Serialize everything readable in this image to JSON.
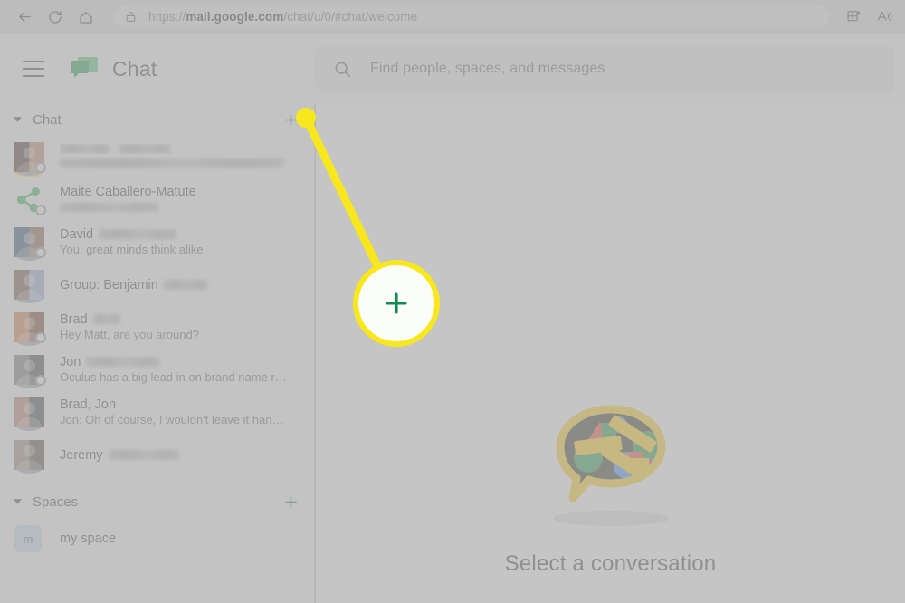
{
  "browser": {
    "back_icon": "back-arrow-icon",
    "reload_icon": "reload-icon",
    "home_icon": "home-icon",
    "lock_icon": "lock-icon",
    "url_prefix": "https://",
    "url_domain": "mail.google.com",
    "url_path": "/chat/u/0/#chat/welcome",
    "url_full": "https://mail.google.com/chat/u/0/#chat/welcome",
    "collections_icon": "add-to-collections-icon",
    "read_aloud_icon": "read-aloud-icon"
  },
  "header": {
    "menu_icon": "hamburger-menu-icon",
    "logo_icon": "google-chat-logo-icon",
    "title": "Chat"
  },
  "search": {
    "icon": "search-icon",
    "placeholder": "Find people, spaces, and messages"
  },
  "sidebar": {
    "chat_section": {
      "label": "Chat",
      "caret_icon": "caret-down-icon",
      "add_icon": "plus-icon"
    },
    "conversations": [
      {
        "name": "",
        "name_redacted": true,
        "preview": "",
        "preview_redacted": true,
        "avatar": "photo-woman",
        "avatar_ring": true,
        "status": true
      },
      {
        "name": "Maite Caballero-Matute",
        "name_redacted": false,
        "preview": "",
        "preview_redacted": true,
        "avatar": "share-network-icon",
        "avatar_ring": false,
        "status": true
      },
      {
        "name": "David",
        "name_redacted": true,
        "preview": "You: great minds think alike",
        "preview_redacted": false,
        "avatar": "photo-group",
        "avatar_ring": false,
        "status": true
      },
      {
        "name": "Group: Benjamin",
        "name_redacted": true,
        "preview": "",
        "preview_redacted": false,
        "avatar": "photo-split-two",
        "avatar_ring": false,
        "status": false
      },
      {
        "name": "Brad",
        "name_redacted": true,
        "preview": "Hey Matt, are you around?",
        "preview_redacted": false,
        "avatar": "photo-man-orange",
        "avatar_ring": false,
        "status": true
      },
      {
        "name": "Jon",
        "name_redacted": true,
        "preview": "Oculus has a big lead in on brand name r…",
        "preview_redacted": false,
        "avatar": "photo-man-gray",
        "avatar_ring": false,
        "status": true
      },
      {
        "name": "Brad, Jon",
        "name_redacted": false,
        "preview": "Jon: Oh of course, I wouldn't leave it han…",
        "preview_redacted": false,
        "avatar": "photo-split-two-dark",
        "avatar_ring": false,
        "status": false
      },
      {
        "name": "Jeremy",
        "name_redacted": true,
        "preview": "",
        "preview_redacted": false,
        "avatar": "photo-man-glasses",
        "avatar_ring": false,
        "status": false
      }
    ],
    "spaces_section": {
      "label": "Spaces",
      "caret_icon": "caret-down-icon",
      "add_icon": "plus-icon"
    },
    "spaces": [
      {
        "initial": "m",
        "name": "my space"
      }
    ]
  },
  "main": {
    "illustration_icon": "chat-bubble-shapes-illustration",
    "empty_text": "Select a conversation"
  },
  "callout": {
    "target_icon": "plus-icon",
    "ring_color": "#f8e71c",
    "plus_color": "#108a4e"
  },
  "colors": {
    "accent_green": "#137333",
    "highlight_yellow": "#f8e71c",
    "text_primary": "#3c4043",
    "text_secondary": "#5f6368",
    "dim_overlay": "#b4b4b4"
  }
}
